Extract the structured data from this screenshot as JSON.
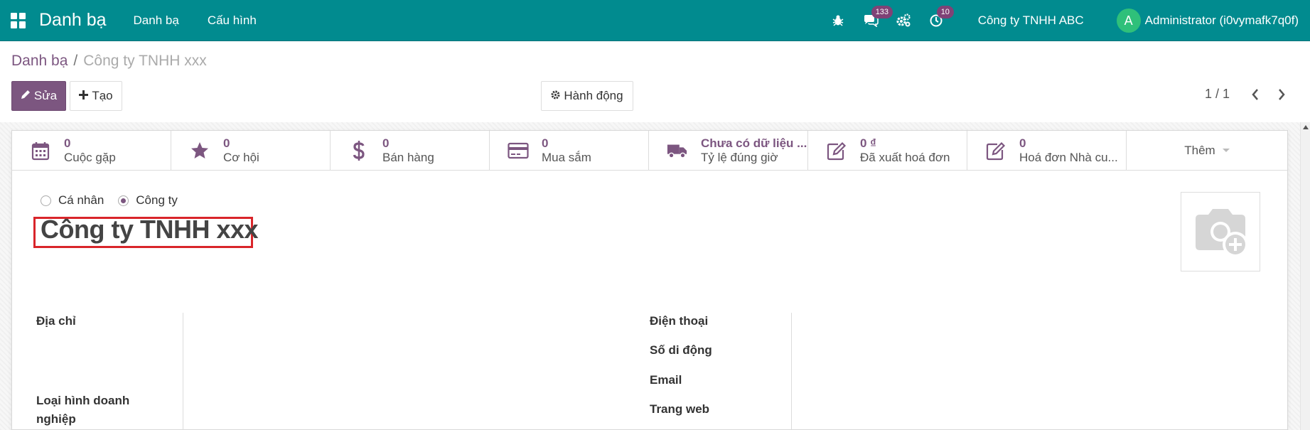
{
  "navbar": {
    "app_title": "Danh bạ",
    "menus": [
      "Danh bạ",
      "Cấu hình"
    ],
    "messages_count": "133",
    "activities_count": "10",
    "company": "Công ty TNHH ABC",
    "avatar_letter": "A",
    "user": "Administrator (i0vymafk7q0f)"
  },
  "breadcrumb": {
    "parent": "Danh bạ",
    "separator": "/",
    "current": "Công ty TNHH xxx"
  },
  "toolbar": {
    "edit_label": "Sửa",
    "create_label": "Tạo",
    "action_label": "Hành động"
  },
  "pager": {
    "value": "1 / 1"
  },
  "smart_buttons": [
    {
      "value": "0",
      "label": "Cuộc gặp",
      "icon": "calendar-icon"
    },
    {
      "value": "0",
      "label": "Cơ hội",
      "icon": "star-icon"
    },
    {
      "value": "0",
      "label": "Bán hàng",
      "icon": "dollar-icon"
    },
    {
      "value": "0",
      "label": "Mua sắm",
      "icon": "credit-card-icon"
    },
    {
      "value": "Chưa có dữ liệu ...",
      "label": "Tỷ lệ đúng giờ",
      "icon": "truck-icon"
    },
    {
      "value": "0 ₫",
      "label": "Đã xuất hoá đơn",
      "icon": "pencil-square-icon"
    },
    {
      "value": "0",
      "label": "Hoá đơn Nhà cu...",
      "icon": "pencil-square-icon"
    }
  ],
  "smart_more_label": "Thêm",
  "partner_type": {
    "options": [
      "Cá nhân",
      "Công ty"
    ],
    "selected": "Công ty"
  },
  "partner_name": "Công ty TNHH xxx",
  "fields_left": {
    "address": "Địa chỉ",
    "business_type": "Loại hình doanh nghiệp"
  },
  "fields_right": {
    "phone": "Điện thoại",
    "mobile": "Số di động",
    "email": "Email",
    "website": "Trang web"
  },
  "colors": {
    "navbar": "#018b8f",
    "primary": "#7c5680",
    "highlight": "#d9252a"
  }
}
